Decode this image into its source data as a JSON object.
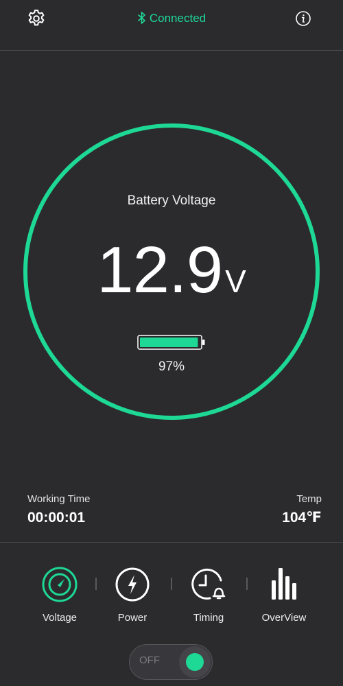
{
  "header": {
    "status_text": "Connected",
    "status_icon": "bluetooth-icon",
    "settings_icon": "gear-icon",
    "info_icon": "info-icon"
  },
  "gauge": {
    "title": "Battery Voltage",
    "value": "12.9",
    "unit": "V",
    "battery_percent_text": "97%",
    "battery_level": 0.97
  },
  "stats": {
    "working_time_label": "Working Time",
    "working_time_value": "00:00:01",
    "temp_label": "Temp",
    "temp_value": "104℉"
  },
  "nav": {
    "items": [
      {
        "label": "Voltage",
        "icon": "gauge-icon",
        "active": true
      },
      {
        "label": "Power",
        "icon": "lightning-icon",
        "active": false
      },
      {
        "label": "Timing",
        "icon": "clock-alarm-icon",
        "active": false
      },
      {
        "label": "OverView",
        "icon": "bar-chart-icon",
        "active": false
      }
    ]
  },
  "toggle": {
    "label": "OFF"
  },
  "colors": {
    "accent": "#1ed895",
    "background": "#2b2b2e",
    "text": "#ffffff"
  }
}
